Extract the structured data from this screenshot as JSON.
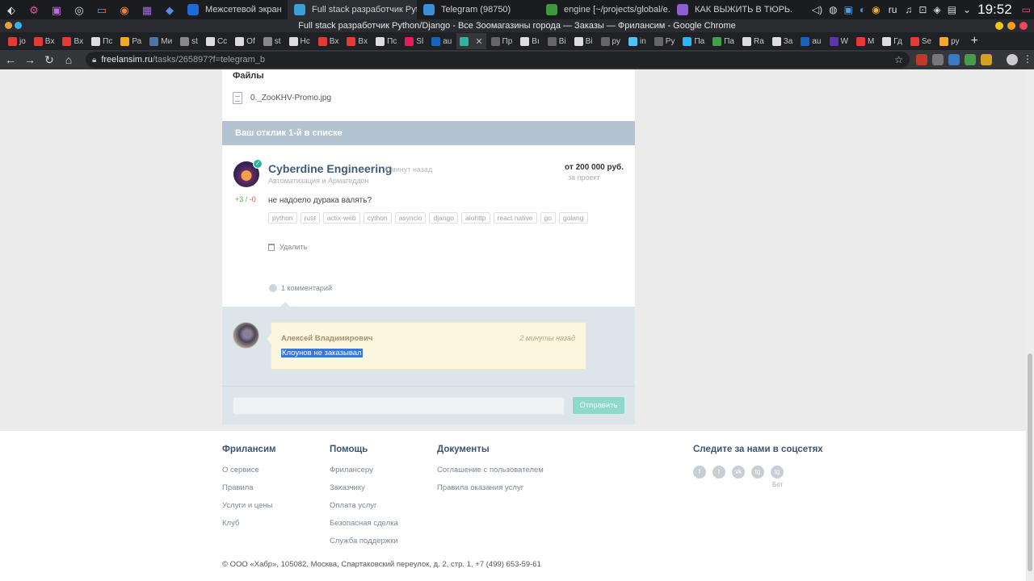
{
  "taskbar": {
    "tasks": [
      {
        "label": "Межсетевой экран",
        "color": "#1e6ad8"
      },
      {
        "label": "Full stack разработчик Pyt...",
        "color": "#3aa0d8"
      },
      {
        "label": "Telegram (98750)",
        "color": "#3a8fd8"
      },
      {
        "label": "engine [~/projects/global/e...",
        "color": "#3c9a3c"
      },
      {
        "label": "КАК ВЫЖИТЬ В ТЮРЬ...",
        "color": "#8e5fd0"
      }
    ],
    "lang": "ru",
    "clock": "19:52"
  },
  "browser": {
    "window_title": "Full stack разработчик Python/Django - Все Зоомагазины города — Заказы — Фрилансим - Google Chrome",
    "tabs": [
      {
        "label": "jo",
        "color": "#e53935"
      },
      {
        "label": "Bx",
        "color": "#e53935"
      },
      {
        "label": "Bx",
        "color": "#e53935"
      },
      {
        "label": "Пс",
        "color": "#dddddd"
      },
      {
        "label": "Ра",
        "color": "#f5a623"
      },
      {
        "label": "Ми",
        "color": "#4a76a8"
      },
      {
        "label": "st",
        "color": "#888888"
      },
      {
        "label": "Cc",
        "color": "#dddddd"
      },
      {
        "label": "Of",
        "color": "#dddddd"
      },
      {
        "label": "st",
        "color": "#888888"
      },
      {
        "label": "Hc",
        "color": "#dddddd"
      },
      {
        "label": "Bx",
        "color": "#e53935"
      },
      {
        "label": "Bx",
        "color": "#e53935"
      },
      {
        "label": "Пс",
        "color": "#dddddd"
      },
      {
        "label": "Sl",
        "color": "#e01e5a"
      },
      {
        "label": "au",
        "color": "#1565c0"
      },
      {
        "label": "",
        "color": "#2bb5a3"
      },
      {
        "label": "Пр",
        "color": "#666666"
      },
      {
        "label": "Bı",
        "color": "#dddddd"
      },
      {
        "label": "Ві",
        "color": "#666666"
      },
      {
        "label": "Ві",
        "color": "#dddddd"
      },
      {
        "label": "ру",
        "color": "#666666"
      },
      {
        "label": "in",
        "color": "#4fc3f7"
      },
      {
        "label": "Ру",
        "color": "#666666"
      },
      {
        "label": "Па",
        "color": "#29b6f6"
      },
      {
        "label": "Па",
        "color": "#43a047"
      },
      {
        "label": "Ra",
        "color": "#dddddd"
      },
      {
        "label": "За",
        "color": "#dddddd"
      },
      {
        "label": "au",
        "color": "#1565c0"
      },
      {
        "label": "W",
        "color": "#5e35b1"
      },
      {
        "label": "M",
        "color": "#e53935"
      },
      {
        "label": "Гд",
        "color": "#dddddd"
      },
      {
        "label": "Se",
        "color": "#e53935"
      },
      {
        "label": "ру",
        "color": "#f9a825"
      }
    ],
    "active_tab_close": "✕",
    "url_host": "freelansim.ru",
    "url_path": "/tasks/265897?f=telegram_b"
  },
  "page": {
    "files_title": "Файлы",
    "file_name": "0._ZooKHV-Promo.jpg",
    "reply_bar": "Ваш отклик 1-й в списке",
    "response": {
      "name": "Cyberdine Engineering",
      "time": "7 минут назад",
      "subtitle": "Автоматизация и Армагеддон",
      "price": "от 200 000 руб.",
      "price_note": "за проект",
      "rating_pos": "+3",
      "rating_sep": " / ",
      "rating_neg": "-0",
      "text": "не надоело дурака валять?",
      "tags": [
        "python",
        "rust",
        "actix-web",
        "cython",
        "asyncio",
        "django",
        "aiohttp",
        "react native",
        "go",
        "golang"
      ],
      "delete_label": "Удалить",
      "comments_label": "1 комментарий"
    },
    "comment": {
      "author": "Алексей Владимирович",
      "time": "2 минуты назад",
      "text": "Клоунов не заказывал"
    },
    "reply_form": {
      "send_label": "Отправить"
    }
  },
  "footer": {
    "columns": [
      {
        "title": "Фрилансим",
        "links": [
          "О сервисе",
          "Правила",
          "Услуги и цены",
          "Клуб"
        ]
      },
      {
        "title": "Помощь",
        "links": [
          "Фрилансеру",
          "Заказчику",
          "Оплата услуг",
          "Безопасная сделка",
          "Служба поддержки"
        ]
      },
      {
        "title": "Документы",
        "links": [
          "Соглашение с пользователем",
          "Правила оказания услуг"
        ]
      }
    ],
    "social_title": "Следите за нами в соцсетях",
    "social": [
      "f",
      "t",
      "vk",
      "tg",
      "tg"
    ],
    "bot_label": "Бот",
    "copyright": "© ООО «Хабр», 105082, Москва, Спартаковский переулок, д. 2, стр. 1, +7 (499) 653-59-61"
  }
}
